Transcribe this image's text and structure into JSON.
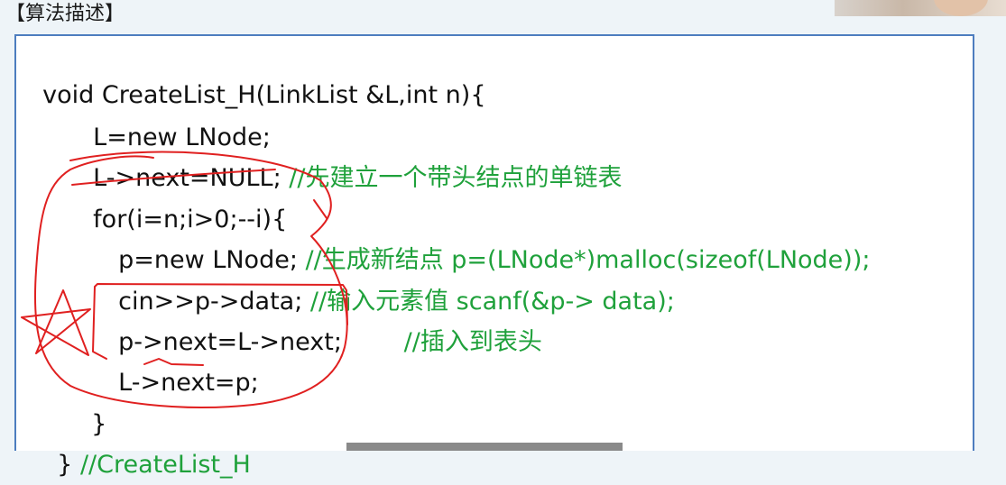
{
  "heading": "【算法描述】",
  "code": {
    "lines": [
      {
        "code": "void CreateList_H(LinkList &L,int n){",
        "comment": ""
      },
      {
        "code": "L=new LNode;",
        "comment": ""
      },
      {
        "code": "L->next=NULL; ",
        "comment": "//先建立一个带头结点的单链表"
      },
      {
        "code": "for(i=n;i>0;--i){",
        "comment": ""
      },
      {
        "code": "p=new LNode; ",
        "comment": "//生成新结点 p=(LNode*)malloc(sizeof(LNode));"
      },
      {
        "code": "cin>>p->data; ",
        "comment": "//输入元素值 scanf(&p-> data);"
      },
      {
        "code": "p->next=L->next;        ",
        "comment": "//插入到表头"
      },
      {
        "code": "L->next=p;",
        "comment": ""
      },
      {
        "code": "}",
        "comment": ""
      },
      {
        "code": "} ",
        "comment": "//CreateList_H"
      }
    ]
  },
  "colors": {
    "comment": "#1fa13b",
    "annotation_ink": "#e02020",
    "panel_border": "#4d7dbf"
  }
}
